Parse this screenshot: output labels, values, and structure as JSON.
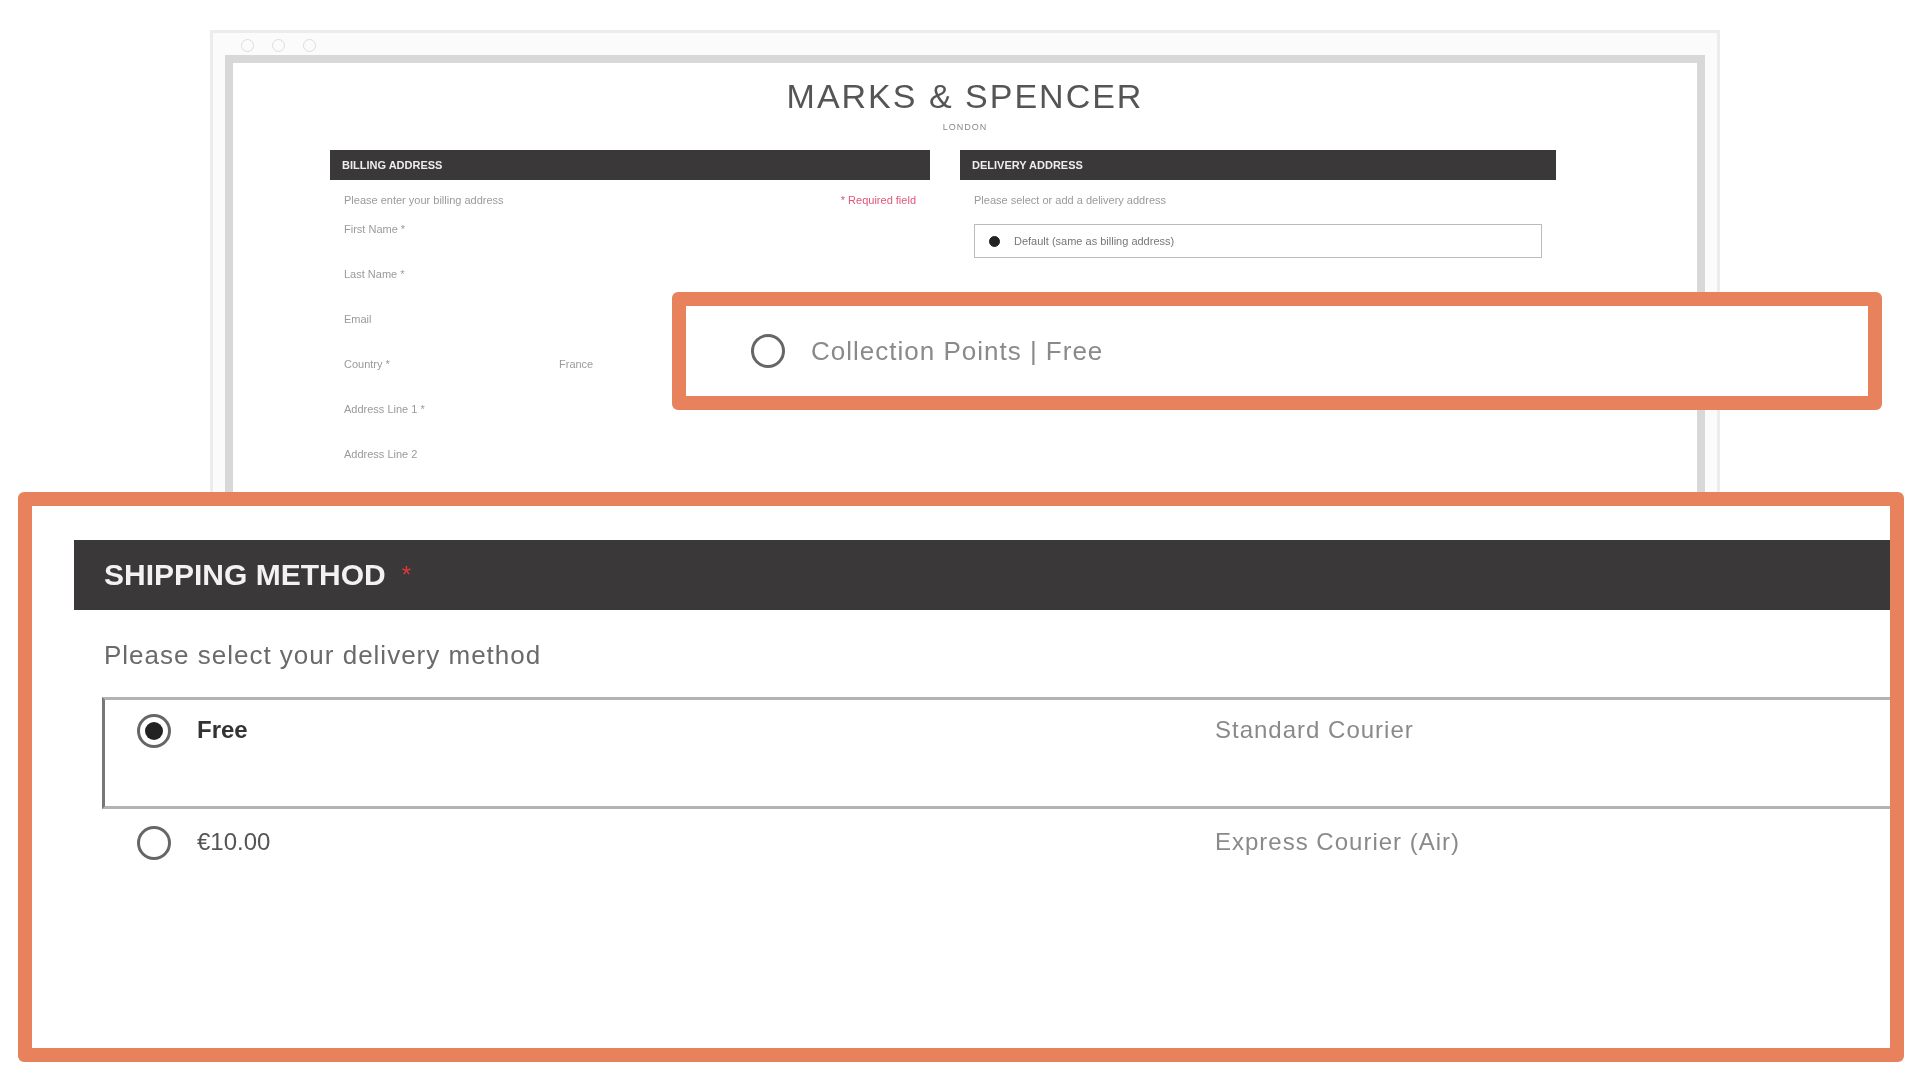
{
  "browser": {
    "logo": "MARKS & SPENCER",
    "subtitle": "LONDON",
    "billing": {
      "title": "BILLING ADDRESS",
      "intro": "Please enter your billing address",
      "required_note": "* Required field",
      "fields": [
        {
          "label": "First Name *"
        },
        {
          "label": "Last Name *"
        },
        {
          "label": "Email"
        },
        {
          "label": "Country *",
          "value": "France"
        },
        {
          "label": "Address Line 1 *"
        },
        {
          "label": "Address Line 2"
        }
      ]
    },
    "delivery": {
      "title": "DELIVERY ADDRESS",
      "intro": "Please select or add a delivery address",
      "options": [
        {
          "label": "Default (same as billing address)",
          "selected": true
        }
      ]
    }
  },
  "collection_callout": {
    "option": {
      "label": "Collection Points | Free",
      "selected": false
    }
  },
  "shipping_callout": {
    "title": "SHIPPING METHOD",
    "required_mark": "*",
    "intro": "Please select your delivery method",
    "options": [
      {
        "price": "Free",
        "name": "Standard Courier",
        "selected": true
      },
      {
        "price": "€10.00",
        "name": "Express Courier (Air)",
        "selected": false
      }
    ]
  }
}
